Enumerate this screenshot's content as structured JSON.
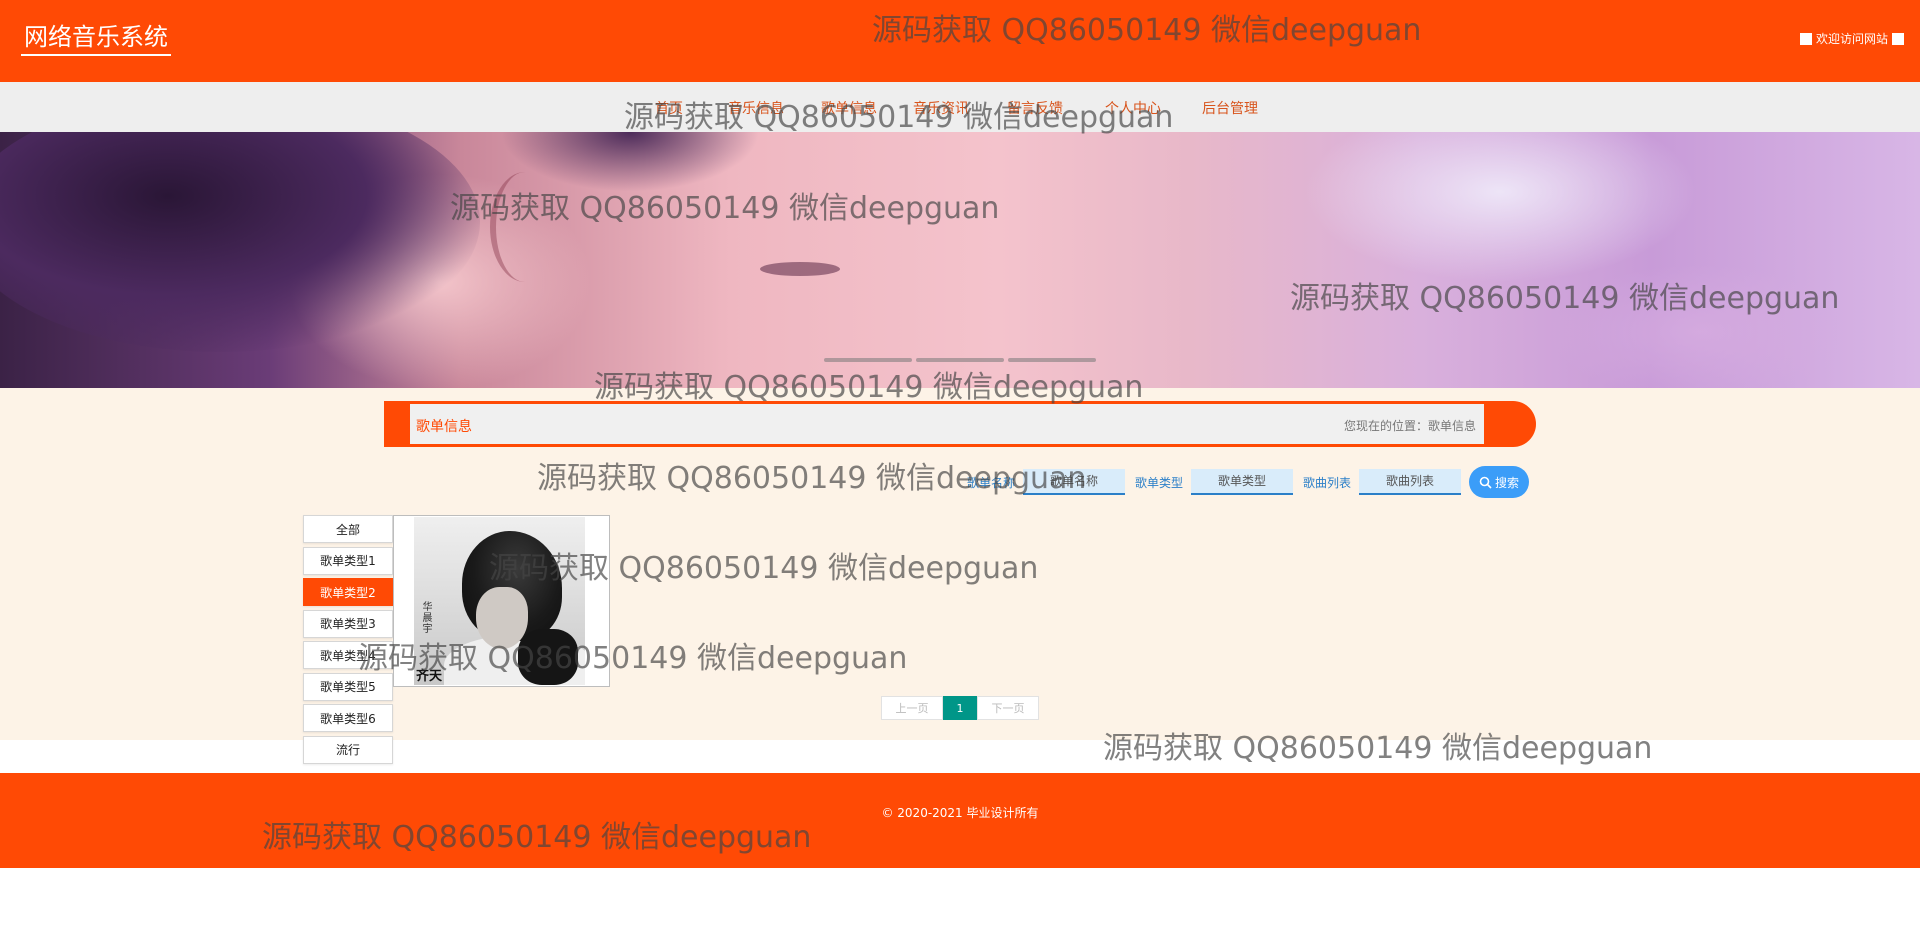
{
  "header": {
    "title": "网络音乐系统",
    "welcome": "欢迎访问网站"
  },
  "nav": {
    "items": [
      "首页",
      "音乐信息",
      "歌单信息",
      "音乐资讯",
      "留言反馈",
      "个人中心",
      "后台管理"
    ]
  },
  "panel": {
    "title": "歌单信息",
    "breadcrumb": "您现在的位置：歌单信息"
  },
  "search": {
    "fields": [
      {
        "label": "歌单名称",
        "placeholder": "歌单名称"
      },
      {
        "label": "歌单类型",
        "placeholder": "歌单类型"
      },
      {
        "label": "歌曲列表",
        "placeholder": "歌曲列表"
      }
    ],
    "button": "搜索"
  },
  "categories": {
    "items": [
      "全部",
      "歌单类型1",
      "歌单类型2",
      "歌单类型3",
      "歌单类型4",
      "歌单类型5",
      "歌单类型6",
      "流行"
    ],
    "active": "歌单类型2"
  },
  "playlist_card": {
    "cover_vertical_text": "华晨宇",
    "cover_text": "齐天"
  },
  "pagination": {
    "prev": "上一页",
    "current": "1",
    "next": "下一页"
  },
  "footer": {
    "copyright": "© 2020-2021 毕业设计所有"
  },
  "watermark": "源码获取 QQ86050149 微信deepguan",
  "colors": {
    "brand": "#ff4a05",
    "nav_text": "#d8541c",
    "search_blue": "#2b7fc8",
    "search_button": "#3b9df8",
    "pager_active": "#009688",
    "content_bg": "#fdf3e7"
  }
}
